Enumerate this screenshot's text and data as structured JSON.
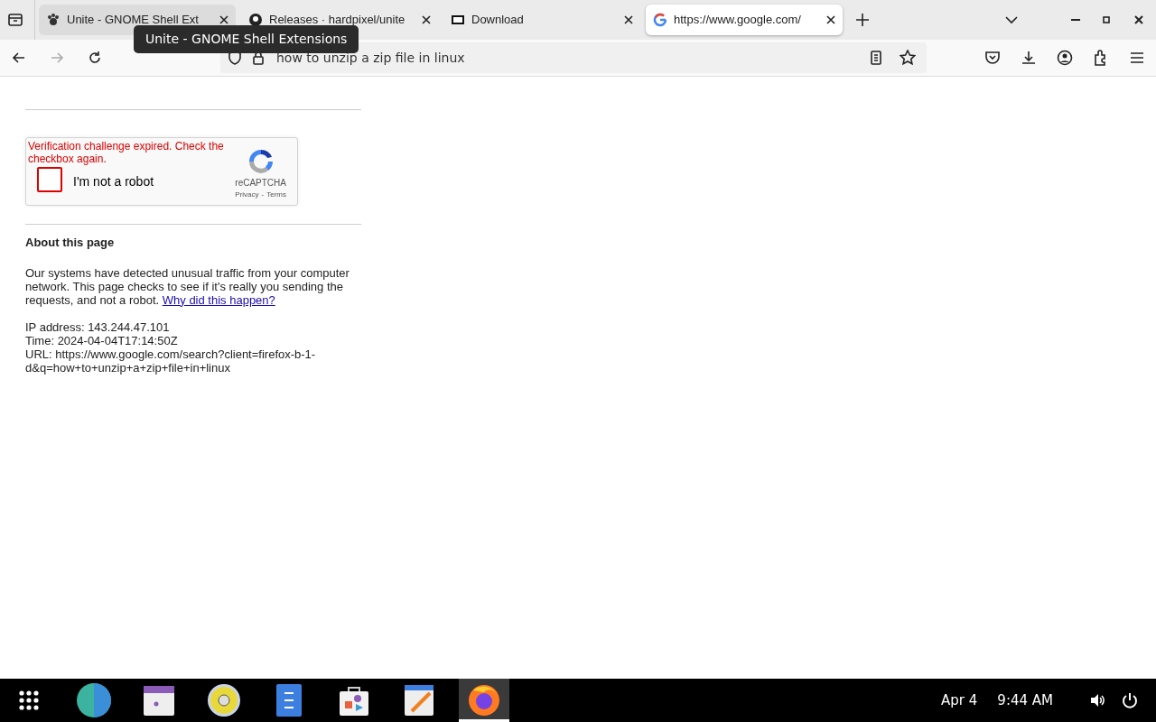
{
  "tabs": [
    {
      "title": "Unite - GNOME Shell Ext",
      "selected": false,
      "hovered": true
    },
    {
      "title": "Releases · hardpixel/unite",
      "selected": false,
      "hovered": false
    },
    {
      "title": "Download",
      "selected": false,
      "hovered": false
    },
    {
      "title": "https://www.google.com/",
      "selected": true,
      "hovered": false
    }
  ],
  "tooltip": "Unite - GNOME Shell Extensions",
  "address_bar": {
    "value": "how to unzip a zip file in linux"
  },
  "captcha": {
    "error": "Verification challenge expired. Check the checkbox again.",
    "label": "I'm not a robot",
    "checked": false,
    "brand": "reCAPTCHA",
    "privacy": "Privacy",
    "separator": "-",
    "terms": "Terms"
  },
  "about": {
    "heading": "About this page",
    "text": "Our systems have detected unusual traffic from your computer network. This page checks to see if it's really you sending the requests, and not a robot.",
    "link": "Why did this happen?",
    "details": [
      "IP address: 143.244.47.101",
      "Time: 2024-04-04T17:14:50Z",
      "URL: https://www.google.com/search?client=firefox-b-1-d&q=how+to+unzip+a+zip+file+in+linux"
    ]
  },
  "taskbar": {
    "apps": [
      {
        "selected": false
      },
      {
        "selected": false
      },
      {
        "selected": false
      },
      {
        "selected": false
      },
      {
        "selected": false
      },
      {
        "selected": false
      },
      {
        "selected": false
      },
      {
        "selected": true
      }
    ],
    "date": "Apr 4",
    "time": "9:44 AM"
  }
}
